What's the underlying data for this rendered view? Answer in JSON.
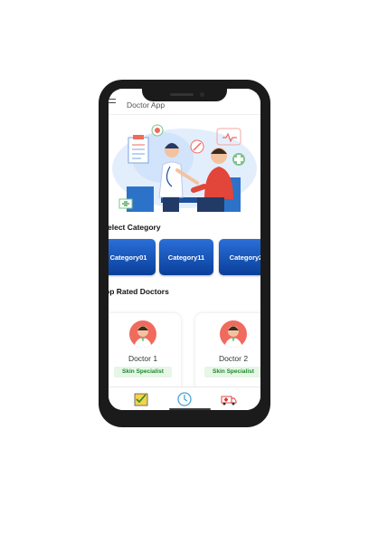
{
  "app": {
    "title": "Doctor App"
  },
  "sections": {
    "category_title": "elect Category",
    "top_rated_title": "op Rated Doctors"
  },
  "categories": [
    "Category01",
    "Category11",
    "Category2"
  ],
  "doctors": [
    {
      "name": "Doctor 1",
      "specialty": "Skin Specialist"
    },
    {
      "name": "Doctor 2",
      "specialty": "Skin Specialist"
    }
  ],
  "bottom_nav": [
    "checklist-icon",
    "clock-icon",
    "ambulance-icon"
  ],
  "colors": {
    "category_bg": "#0a3f9a",
    "avatar_bg": "#f06a5e",
    "specialty_text": "#1c8a2a",
    "accent_blue": "#2a6fd8"
  }
}
